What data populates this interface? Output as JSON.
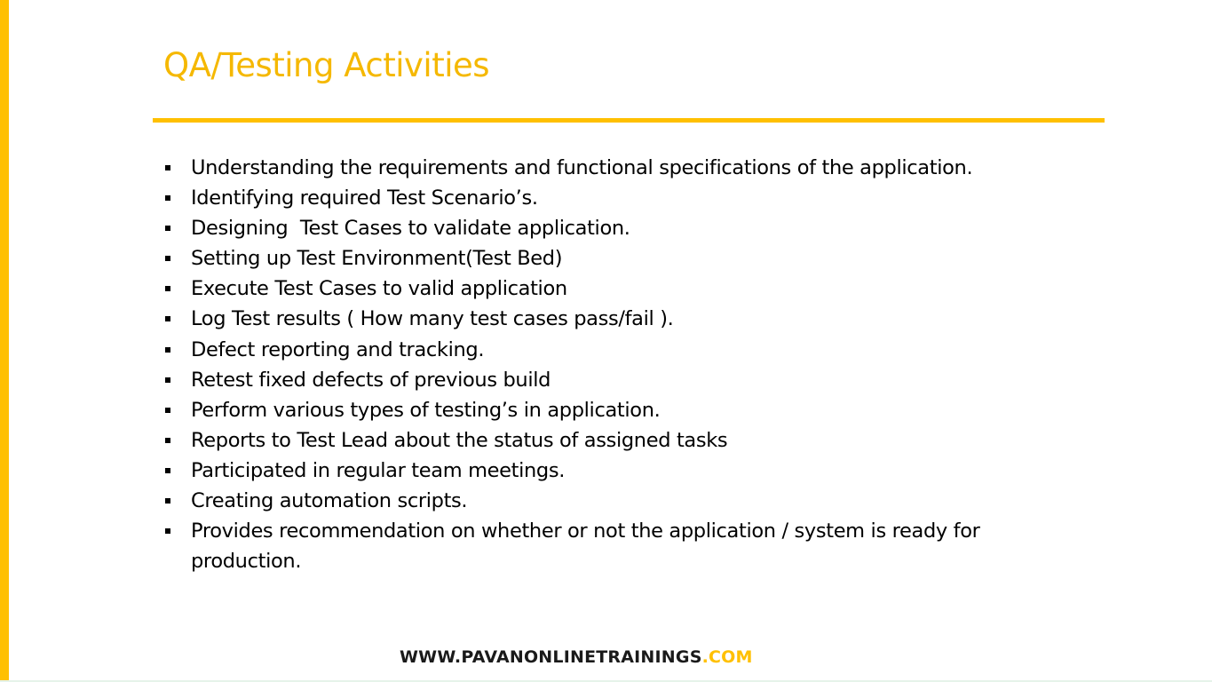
{
  "slide": {
    "title": "QA/Testing Activities",
    "accent_color": "#FFC000",
    "bullet_icon": "square-bullet-icon",
    "bullets": [
      "Understanding the requirements and functional specifications of the application.",
      "Identifying required Test Scenario’s.",
      "Designing  Test Cases to validate application.",
      "Setting up Test Environment(Test Bed)",
      "Execute Test Cases to valid application",
      "Log Test results ( How many test cases pass/fail ).",
      "Defect reporting and tracking.",
      "Retest fixed defects of previous build",
      "Perform various types of testing’s in application.",
      "Reports to Test Lead about the status of assigned tasks",
      "Participated in regular team meetings.",
      "Creating automation scripts.",
      "Provides recommendation on whether or not the application / system is ready for production."
    ],
    "footer": {
      "site": "WWW.PAVANONLINETRAININGS",
      "tld": ".COM"
    }
  }
}
